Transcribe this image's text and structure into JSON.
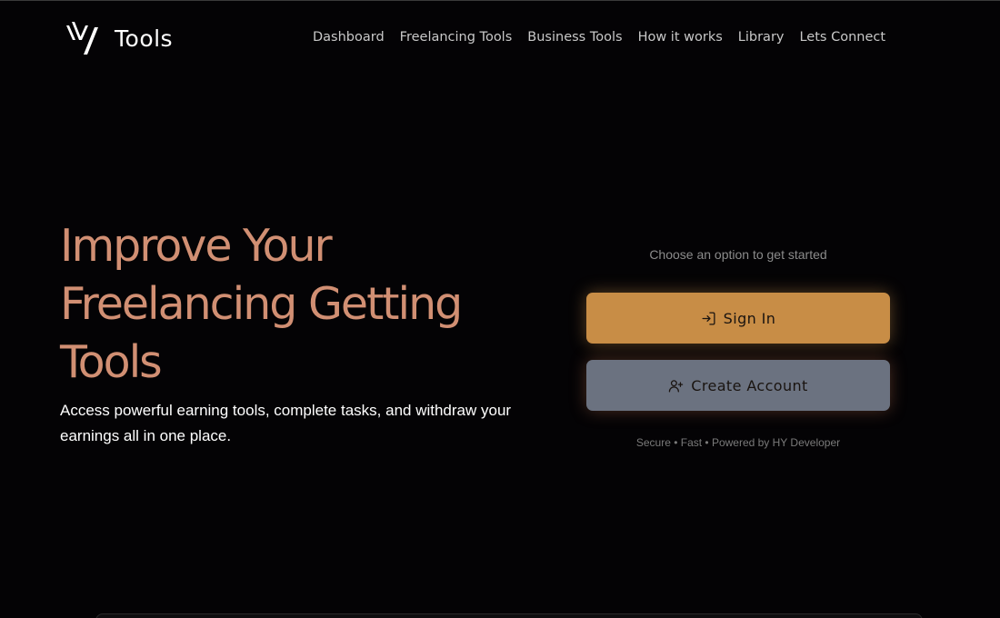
{
  "header": {
    "logo_text": "Tools",
    "logo_icon": "hy-logo-icon",
    "nav": [
      {
        "label": "Dashboard"
      },
      {
        "label": "Freelancing Tools"
      },
      {
        "label": "Business Tools"
      },
      {
        "label": "How it works"
      },
      {
        "label": "Library"
      },
      {
        "label": "Lets Connect"
      }
    ]
  },
  "hero": {
    "title_lines": [
      "Improve Your",
      "Freelancing Getting",
      "Tools"
    ],
    "subtitle": "Access powerful earning tools, complete tasks, and withdraw your earnings all in one place."
  },
  "auth": {
    "prompt": "Choose an option to get started",
    "sign_in_label": "Sign In",
    "sign_in_icon": "login-icon",
    "create_label": "Create Account",
    "create_icon": "user-plus-icon",
    "footnote": "Secure • Fast • Powered by HY Developer"
  },
  "colors": {
    "background": "#040305",
    "accent_title": "#d18f73",
    "sign_in_bg": "#c88d46",
    "create_bg": "#6b7280"
  }
}
